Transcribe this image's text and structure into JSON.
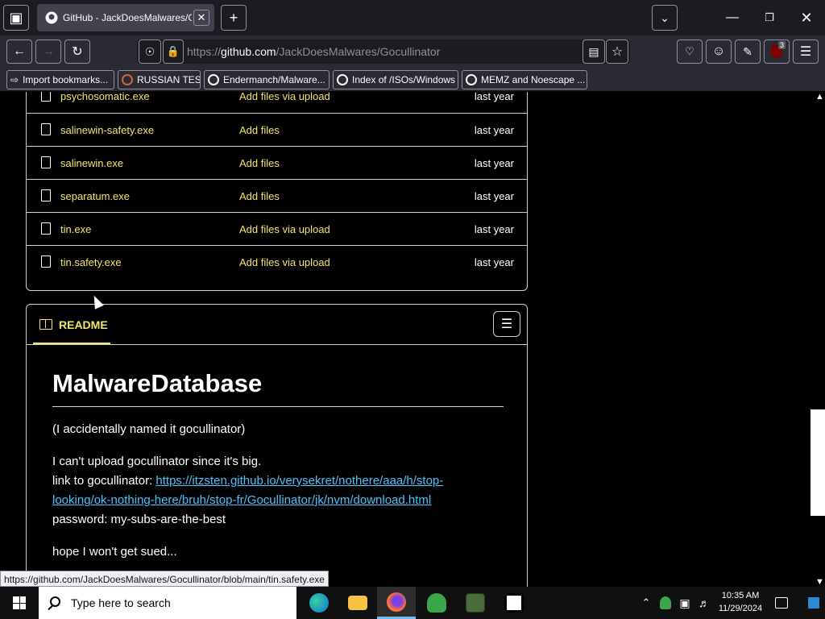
{
  "browser": {
    "tab_title": "GitHub - JackDoesMalwares/Gocullinator",
    "url_prefix": "https://",
    "url_host": "github.com",
    "url_path": "/JackDoesMalwares/Gocullinator",
    "bookmarks": [
      "Import bookmarks...",
      "RUSSIAN TEST",
      "Endermanch/Malware...",
      "Index of /ISOs/Windows",
      "MEMZ and Noescape ..."
    ],
    "extension_badge": "3",
    "status_url": "https://github.com/JackDoesMalwares/Gocullinator/blob/main/tin.safety.exe"
  },
  "files": [
    {
      "name": "psychosomatic.exe",
      "message": "Add files via upload",
      "date": "last year"
    },
    {
      "name": "salinewin-safety.exe",
      "message": "Add files",
      "date": "last year"
    },
    {
      "name": "salinewin.exe",
      "message": "Add files",
      "date": "last year"
    },
    {
      "name": "separatum.exe",
      "message": "Add files",
      "date": "last year"
    },
    {
      "name": "tin.exe",
      "message": "Add files via upload",
      "date": "last year"
    },
    {
      "name": "tin.safety.exe",
      "message": "Add files via upload",
      "date": "last year"
    }
  ],
  "readme": {
    "tab_label": "README",
    "heading": "MalwareDatabase",
    "p1": "(I accidentally named it gocullinator)",
    "p2_line1": "I can't upload gocullinator since it's big.",
    "p2_link_label": "link to gocullinator: ",
    "p2_link_part1": "https://itzsten.github.io/verysekret/nothere/aaa/h/stop-",
    "p2_link_part2": "looking/ok-nothing-here/bruh/stop-fr/Gocullinator/jk/nvm/download.html",
    "p2_password": "password: my-subs-are-the-best",
    "p3": "hope I won't get sued..."
  },
  "taskbar": {
    "search_placeholder": "Type here to search",
    "time": "10:35 AM",
    "date": "11/29/2024"
  }
}
